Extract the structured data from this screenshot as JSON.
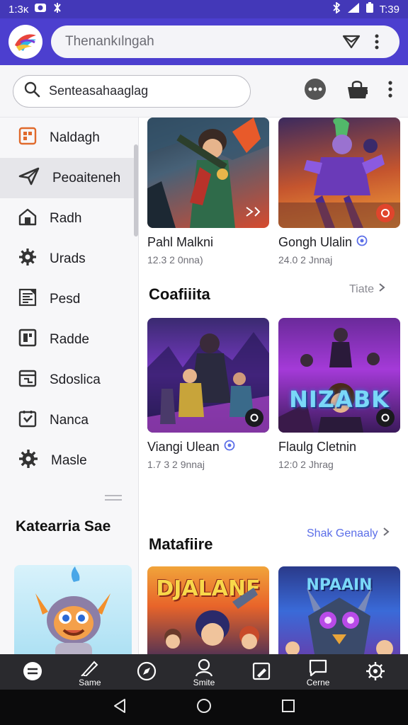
{
  "status_bar": {
    "time_left": "1:3ĸ",
    "time_right": "T:39"
  },
  "app_bar": {
    "search_placeholder": "Thenankılngah",
    "logo_icon": "app-logo-icon"
  },
  "search_bar": {
    "placeholder": "Senteasahaaglag"
  },
  "sidebar": {
    "items": [
      {
        "label": "Naldagh",
        "icon": "grid-icon",
        "color": "#e06a2c"
      },
      {
        "label": "Peoaiteneh",
        "icon": "paper-plane-icon",
        "active": true
      },
      {
        "label": "Radh",
        "icon": "home-icon"
      },
      {
        "label": "Urads",
        "icon": "gear-icon"
      },
      {
        "label": "Pesd",
        "icon": "document-icon"
      },
      {
        "label": "Radde",
        "icon": "square-icon"
      },
      {
        "label": "Sdoslica",
        "icon": "calendar-icon"
      },
      {
        "label": "Nanca",
        "icon": "check-box-icon"
      },
      {
        "label": "Masle",
        "icon": "settings-icon"
      }
    ],
    "section_title": "Katearria Sae"
  },
  "content": {
    "row1": [
      {
        "title": "Pahl Malkni",
        "meta": "12.3 2 0nna)",
        "badge": "external-link-icon"
      },
      {
        "title": "Gongh Ulalin",
        "meta": "24.0 2 Jnnaj",
        "verified": true,
        "badge": "record-icon"
      }
    ],
    "section2": {
      "title": "Coafiiita",
      "link": "Tiate"
    },
    "row2": [
      {
        "title": "Viangi Ulean",
        "meta": "1.7 3 2 9nnaj",
        "verified": true,
        "badge": "camera-icon",
        "thumb_text": ""
      },
      {
        "title": "Flaulg Cletnin",
        "meta": "12:0 2 Jhrag",
        "badge": "camera-icon",
        "thumb_text": "NIZABK"
      }
    ],
    "section3": {
      "title": "Matafiire",
      "link": "Shak Genaaly"
    },
    "row3": [
      {
        "thumb_text": "DJALANF"
      },
      {
        "thumb_text": "NPAAIN"
      }
    ]
  },
  "bottom_nav": [
    {
      "label": "",
      "icon": "menu-icon"
    },
    {
      "label": "Same",
      "icon": "pen-icon"
    },
    {
      "label": "",
      "icon": "compass-icon"
    },
    {
      "label": "Smite",
      "icon": "user-icon"
    },
    {
      "label": "",
      "icon": "edit-box-icon"
    },
    {
      "label": "Cerne",
      "icon": "chat-icon"
    },
    {
      "label": "",
      "icon": "gear-icon"
    }
  ],
  "colors": {
    "accent": "#4c3fcf",
    "verified": "#5b6ee8",
    "link": "#5b6ee8"
  }
}
